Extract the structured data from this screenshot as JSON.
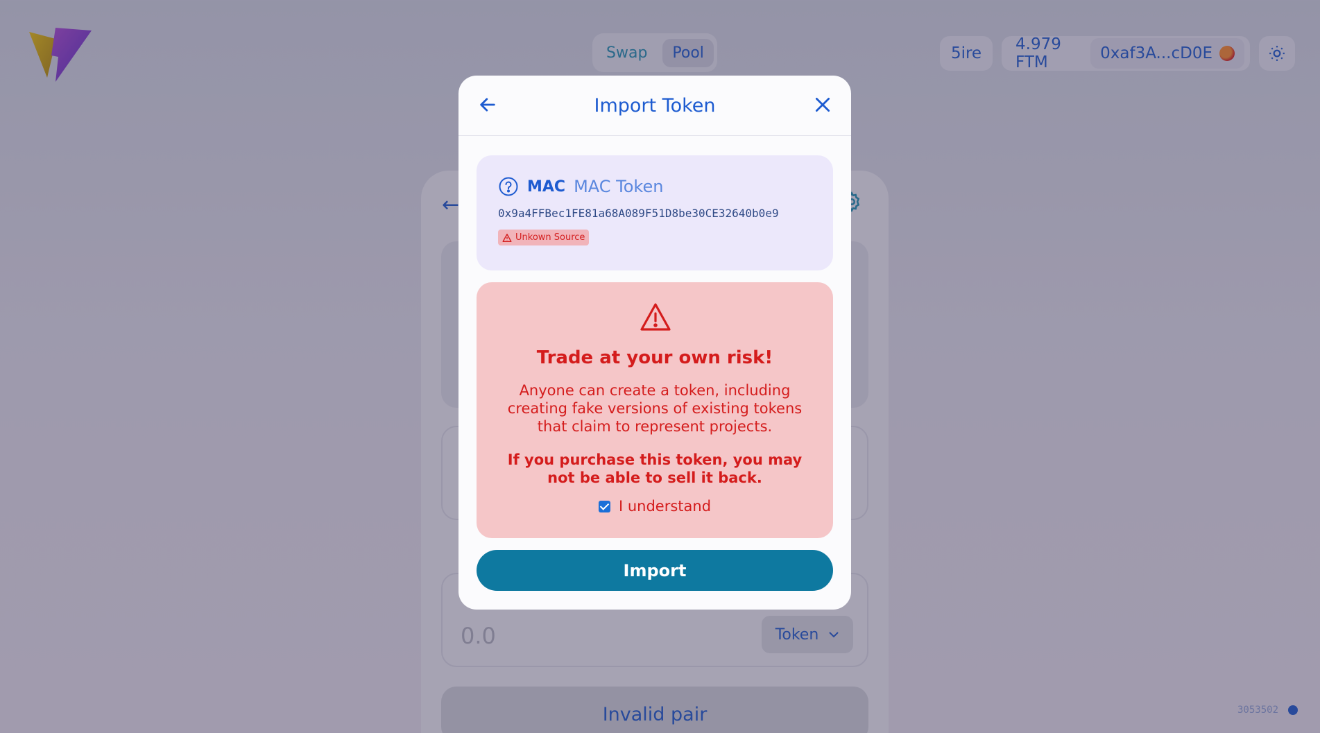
{
  "nav": {
    "tabs": [
      "Swap",
      "Pool"
    ],
    "active": "Pool"
  },
  "header": {
    "network": "5ire",
    "balance": "4.979 FTM",
    "address": "0xaf3A...cD0E"
  },
  "swap_card": {
    "output_amount_placeholder": "0.0",
    "token_select": "Token",
    "action_button": "Invalid pair"
  },
  "build": "3053502",
  "modal": {
    "title": "Import Token",
    "token": {
      "symbol": "MAC",
      "name": "MAC Token",
      "address": "0x9a4FFBec1FE81a68A089F51D8be30CE32640b0e9",
      "badge": "Unkown Source"
    },
    "risk": {
      "title": "Trade at your own risk!",
      "body": "Anyone can create a token, including creating fake versions of existing tokens that claim to represent projects.",
      "warning": "If you purchase this token, you may not be able to sell it back.",
      "checkbox_label": "I understand",
      "checked": true
    },
    "import_button": "Import"
  },
  "colors": {
    "accent": "#1d5bd0",
    "primary_button": "#0e79a0",
    "danger": "#d41c1c",
    "danger_bg": "#f5c6c8",
    "token_card_bg": "#ece8fb"
  }
}
